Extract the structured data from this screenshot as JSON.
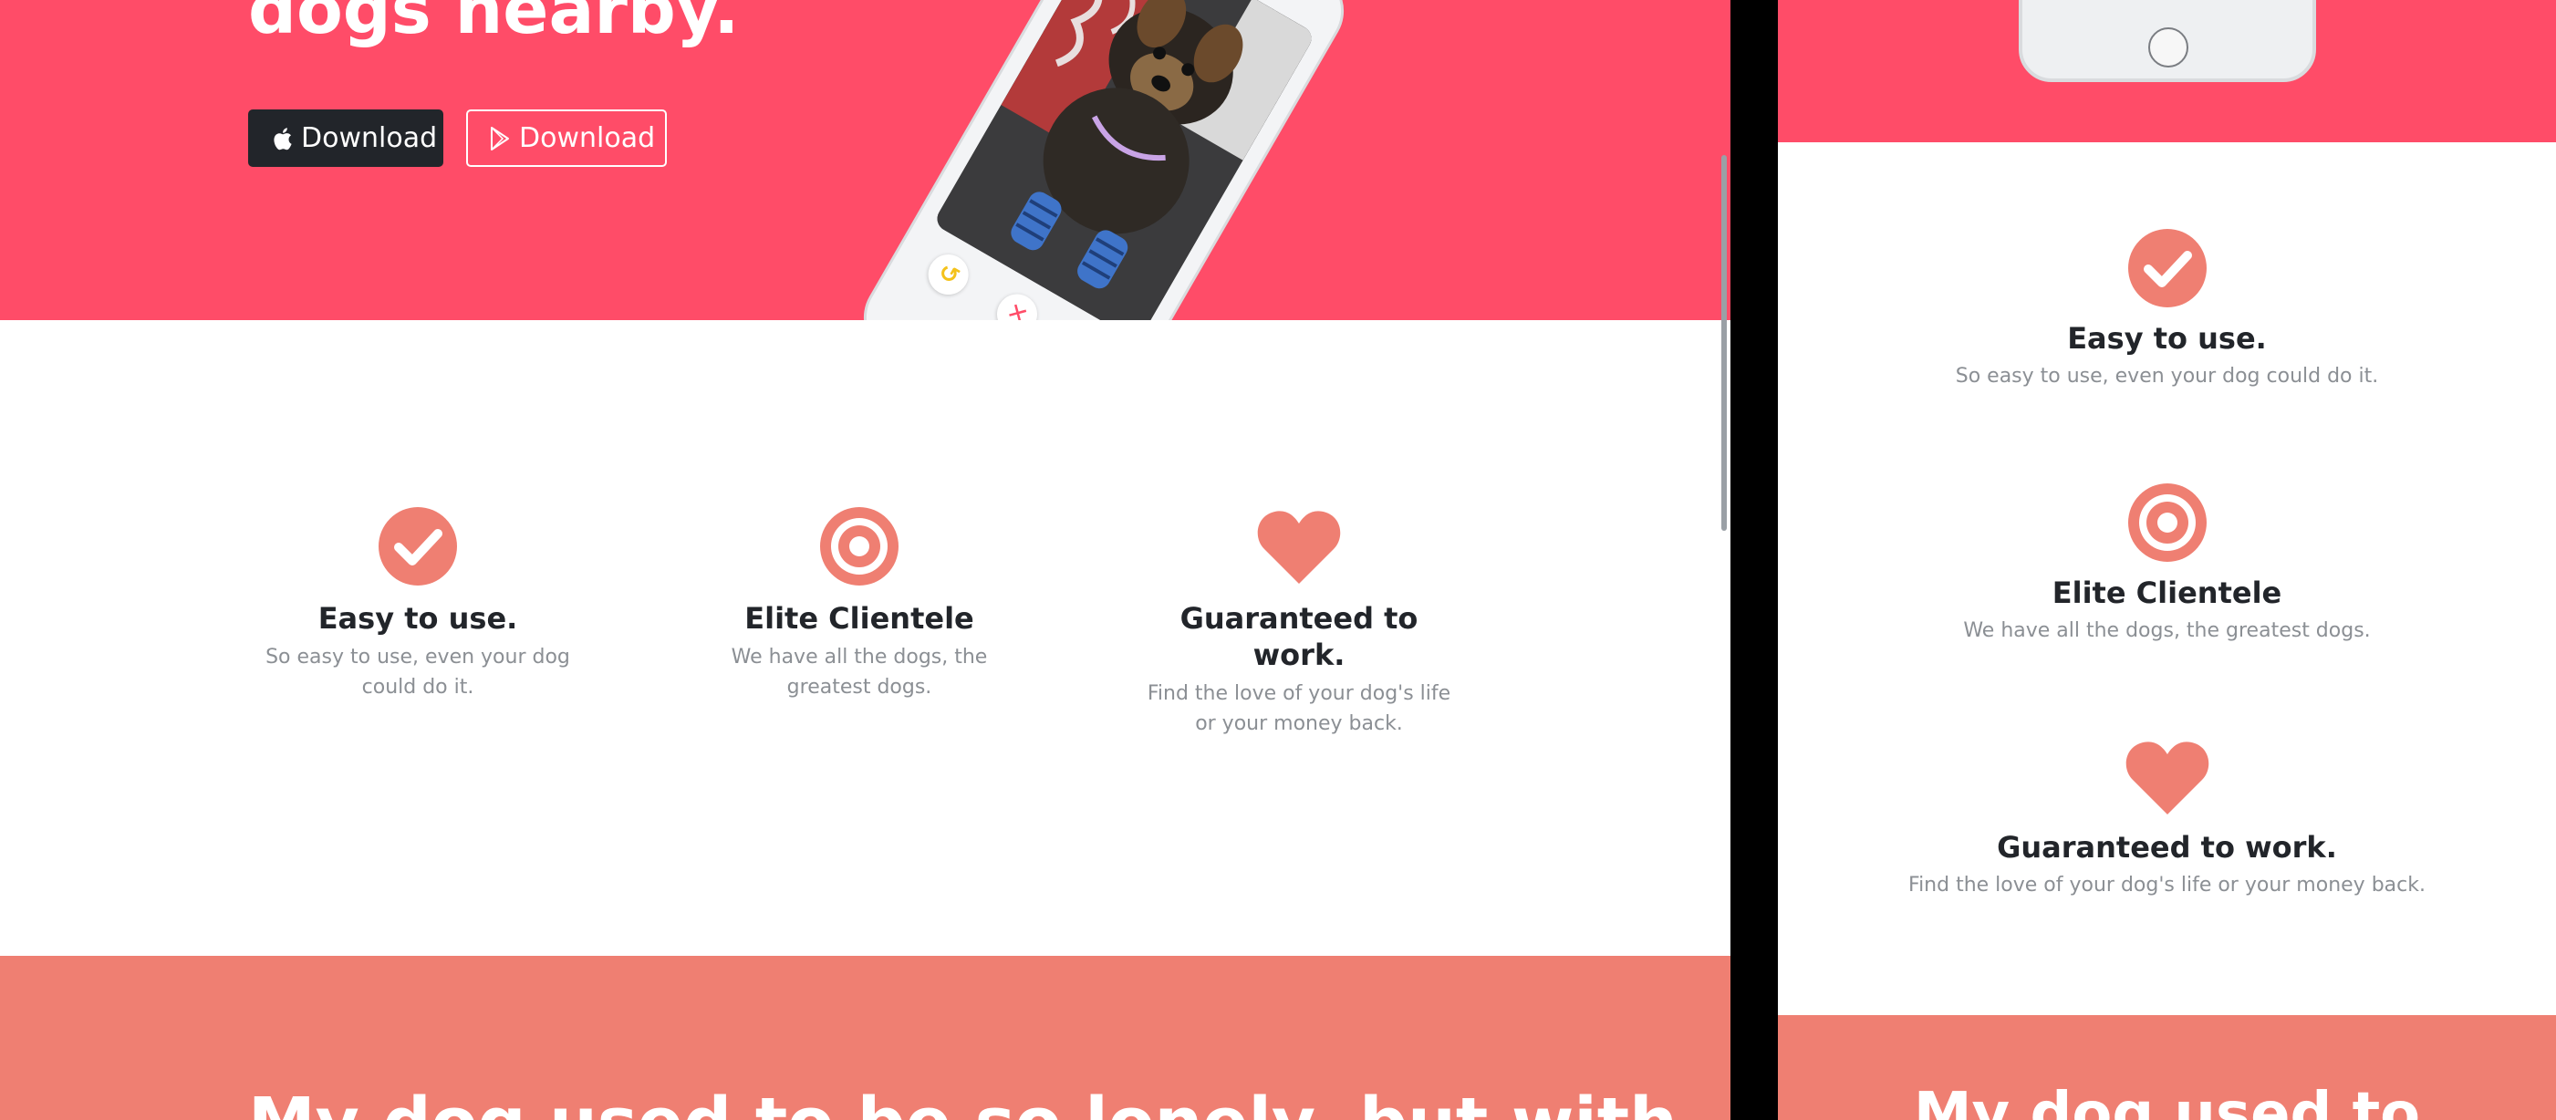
{
  "desktop": {
    "hero": {
      "title": "dogs nearby.",
      "apple_button": "Download",
      "play_button": "Download"
    },
    "features": [
      {
        "icon": "check-circle-icon",
        "title": "Easy to use.",
        "text": "So easy to use, even your dog could do it."
      },
      {
        "icon": "target-icon",
        "title": "Elite Clientele",
        "text": "We have all the dogs, the greatest dogs."
      },
      {
        "icon": "heart-icon",
        "title": "Guaranteed to work.",
        "text": "Find the love of your dog's life or your money back."
      }
    ],
    "testimonial": {
      "quote": "My dog used to be so lonely, but with"
    }
  },
  "mobile": {
    "features": [
      {
        "icon": "check-circle-icon",
        "title": "Easy to use.",
        "text": "So easy to use, even your dog could do it."
      },
      {
        "icon": "target-icon",
        "title": "Elite Clientele",
        "text": "We have all the dogs, the greatest dogs."
      },
      {
        "icon": "heart-icon",
        "title": "Guaranteed to work.",
        "text": "Find the love of your dog's life or your money back."
      }
    ],
    "testimonial": {
      "quote": "My dog used to"
    }
  },
  "colors": {
    "hero_red": "#ff4c68",
    "coral": "#ef7f72",
    "dark_button": "#22252a",
    "muted_text": "#8b8f94"
  }
}
